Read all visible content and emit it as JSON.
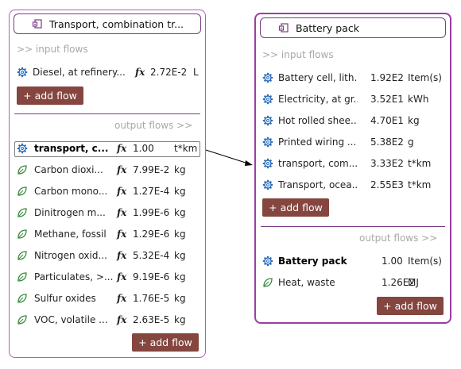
{
  "left": {
    "title": "Transport, combination tr...",
    "input_header": ">> input flows",
    "inputs": [
      {
        "name": "Diesel, at refinery...",
        "amount": "2.72E-2",
        "unit": "L",
        "icon": "gear-icon"
      }
    ],
    "add_input_label": "+ add flow",
    "output_header": "output flows >>",
    "outputs": [
      {
        "name": "transport, c...",
        "amount": "1.00",
        "unit": "t*km",
        "icon": "gear-icon",
        "reference": true
      },
      {
        "name": "Carbon dioxi...",
        "amount": "7.99E-2",
        "unit": "kg",
        "icon": "leaf-icon"
      },
      {
        "name": "Carbon mono...",
        "amount": "1.27E-4",
        "unit": "kg",
        "icon": "leaf-icon"
      },
      {
        "name": "Dinitrogen m...",
        "amount": "1.99E-6",
        "unit": "kg",
        "icon": "leaf-icon"
      },
      {
        "name": "Methane, fossil",
        "amount": "1.29E-6",
        "unit": "kg",
        "icon": "leaf-icon"
      },
      {
        "name": "Nitrogen oxid...",
        "amount": "5.32E-4",
        "unit": "kg",
        "icon": "leaf-icon"
      },
      {
        "name": "Particulates, >...",
        "amount": "9.19E-6",
        "unit": "kg",
        "icon": "leaf-icon"
      },
      {
        "name": "Sulfur oxides",
        "amount": "1.76E-5",
        "unit": "kg",
        "icon": "leaf-icon"
      },
      {
        "name": "VOC, volatile ...",
        "amount": "2.63E-5",
        "unit": "kg",
        "icon": "leaf-icon"
      }
    ],
    "add_output_label": "+ add flow"
  },
  "right": {
    "title": "Battery pack",
    "input_header": ">> input flows",
    "inputs": [
      {
        "name": "Battery cell, lith...",
        "amount": "1.92E2",
        "unit": "Item(s)",
        "icon": "gear-icon"
      },
      {
        "name": "Electricity, at gr...",
        "amount": "3.52E1",
        "unit": "kWh",
        "icon": "gear-icon"
      },
      {
        "name": "Hot rolled shee...",
        "amount": "4.70E1",
        "unit": "kg",
        "icon": "gear-icon"
      },
      {
        "name": "Printed wiring ...",
        "amount": "5.38E2",
        "unit": "g",
        "icon": "gear-icon"
      },
      {
        "name": "transport, com...",
        "amount": "3.33E2",
        "unit": "t*km",
        "icon": "gear-icon"
      },
      {
        "name": "Transport, ocea...",
        "amount": "2.55E3",
        "unit": "t*km",
        "icon": "gear-icon"
      }
    ],
    "add_input_label": "+ add flow",
    "output_header": "output flows >>",
    "outputs": [
      {
        "name": "Battery pack",
        "amount": "1.00",
        "unit": "Item(s)",
        "icon": "gear-icon",
        "bold": true
      },
      {
        "name": "Heat, waste",
        "amount": "1.26E2",
        "unit": "MJ",
        "icon": "leaf-icon"
      }
    ],
    "add_output_label": "+ add flow"
  },
  "fx_symbol": "fx",
  "colors": {
    "node_border": "#9b3fa3",
    "button_bg": "#84463f",
    "gear_icon": "#2a6ebb",
    "leaf_icon": "#3c8a3c",
    "header_text": "#a8a8a8"
  }
}
